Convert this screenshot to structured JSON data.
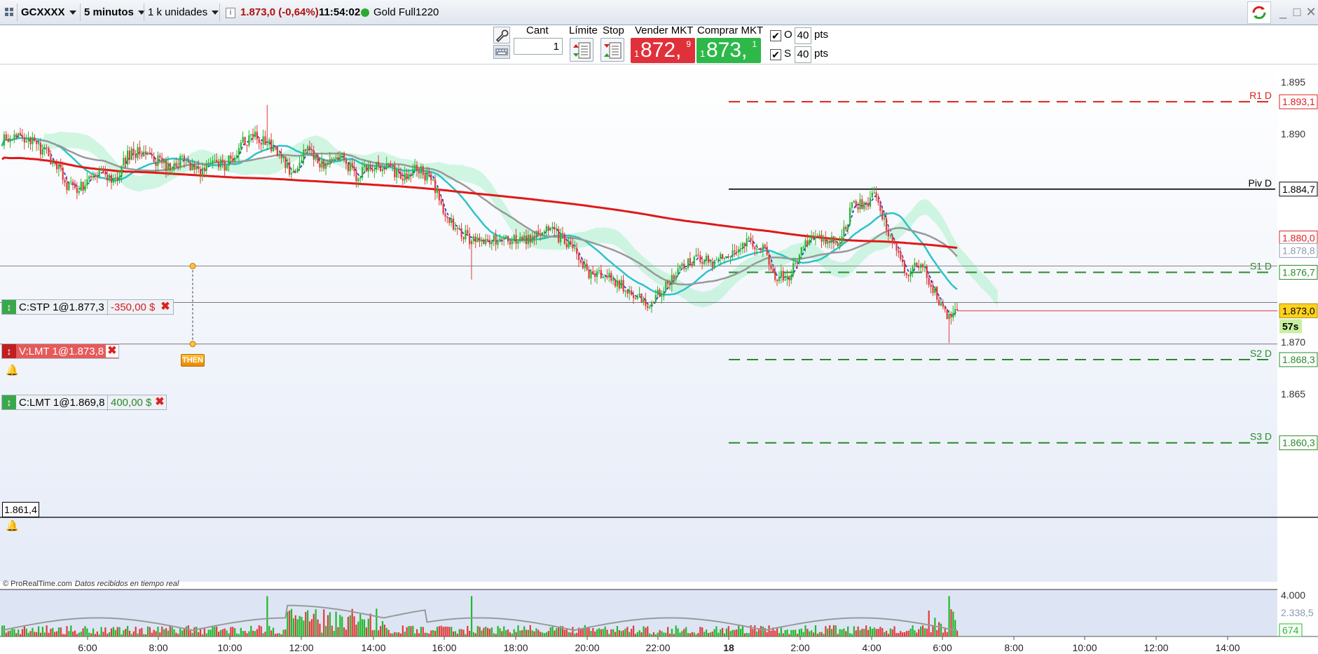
{
  "toolbar": {
    "instrument": "GCXXXX",
    "timeframe": "5 minutos",
    "units": "1 k unidades",
    "info_glyph": "i",
    "last_price": "1.873,0",
    "change": "(-0,64%)",
    "time": "11:54:02",
    "product": "Gold Full1220",
    "status_color": "#2ea82e",
    "icons": [
      "grid-icon",
      "info-icon",
      "sync-icon",
      "minimize-icon",
      "maximize-icon",
      "close-icon"
    ]
  },
  "trading": {
    "qty_label": "Cant",
    "qty_value": "1",
    "limit_label": "Límite",
    "stop_label": "Stop",
    "sell_label": "Vender MKT",
    "buy_label": "Comprar MKT",
    "sell": {
      "qty": "1",
      "price": "872,",
      "sup": "9",
      "color": "#e0303a"
    },
    "buy": {
      "qty": "1",
      "price": "873,",
      "sup": "1",
      "color": "#2fb84a"
    },
    "o_label": "O",
    "o_pts": "40",
    "s_label": "S",
    "s_pts": "40",
    "pts_label": "pts",
    "check_glyph": "✔"
  },
  "orders": [
    {
      "label": "C:STP 1@1.877,3",
      "pnl": "-350,00 $",
      "side": "buy"
    },
    {
      "label": "V:LMT 1@1.873,8",
      "pnl": "",
      "side": "sell"
    },
    {
      "label": "C:LMT 1@1.869,8",
      "pnl": "400,00 $",
      "side": "buy"
    }
  ],
  "order_glyphs": {
    "handle": "↕",
    "close": "✖",
    "bell": "🔔"
  },
  "then_label": "THEN",
  "low_label": "1.861,4",
  "credit": {
    "brand": "© ProRealTime.com",
    "note": "Datos recibidos en tiempo real"
  },
  "chart_data": {
    "type": "candlestick",
    "price_axis_ticks": [
      "1.895",
      "1.890",
      "1.865",
      "1.870",
      "1.865"
    ],
    "price_ticks": [
      1895,
      1890,
      1870,
      1865
    ],
    "price_labels": [
      "1.895",
      "1.890",
      "1.870",
      "1.865"
    ],
    "ylim": [
      1857.0,
      1897.0
    ],
    "time_labels": [
      "6:00",
      "8:00",
      "10:00",
      "12:00",
      "14:00",
      "16:00",
      "18:00",
      "20:00",
      "22:00",
      "18",
      "2:00",
      "4:00",
      "6:00",
      "8:00",
      "10:00",
      "12:00",
      "14:00"
    ],
    "pivots": [
      {
        "name": "R1 D",
        "value": 1893.1,
        "label": "1.893,1",
        "color": "#e02020",
        "style": "dashed"
      },
      {
        "name": "Piv D",
        "value": 1884.7,
        "label": "1.884,7",
        "color": "#000000",
        "style": "solid"
      },
      {
        "name": "S1 D",
        "value": 1876.7,
        "label": "1.876,7",
        "color": "#2a8a2a",
        "style": "dashed"
      },
      {
        "name": "S2 D",
        "value": 1868.3,
        "label": "1.868,3",
        "color": "#2a8a2a",
        "style": "dashed"
      },
      {
        "name": "S3 D",
        "value": 1860.3,
        "label": "1.860,3",
        "color": "#2a8a2a",
        "style": "dashed"
      }
    ],
    "current_price": {
      "value": 1873.0,
      "label": "1.873,0",
      "countdown": "57s"
    },
    "right_labels": [
      {
        "value": 1880.0,
        "label": "1.880,0",
        "color": "#e02020"
      },
      {
        "value": 1878.8,
        "label": "1.878,8",
        "color": "#8a9bb0"
      }
    ],
    "close_path": [
      [
        0,
        1889.5
      ],
      [
        10,
        1889.8
      ],
      [
        20,
        1888.5
      ],
      [
        27,
        1887.0
      ],
      [
        32,
        1884.9
      ],
      [
        38,
        1884.8
      ],
      [
        48,
        1886.5
      ],
      [
        55,
        1885.5
      ],
      [
        62,
        1887.8
      ],
      [
        68,
        1888.4
      ],
      [
        75,
        1887.5
      ],
      [
        82,
        1887.0
      ],
      [
        90,
        1887.5
      ],
      [
        97,
        1886.2
      ],
      [
        104,
        1887.5
      ],
      [
        110,
        1887.0
      ],
      [
        118,
        1889.0
      ],
      [
        124,
        1890.0
      ],
      [
        130,
        1889.3
      ],
      [
        137,
        1887.8
      ],
      [
        144,
        1886.0
      ],
      [
        150,
        1888.5
      ],
      [
        155,
        1887.5
      ],
      [
        160,
        1887.0
      ],
      [
        167,
        1888.0
      ],
      [
        175,
        1885.9
      ],
      [
        180,
        1886.8
      ],
      [
        190,
        1886.8
      ],
      [
        200,
        1885.7
      ],
      [
        205,
        1886.8
      ],
      [
        212,
        1885.5
      ],
      [
        220,
        1882.0
      ],
      [
        226,
        1880.5
      ],
      [
        232,
        1879.9
      ],
      [
        238,
        1879.8
      ],
      [
        262,
        1880.0
      ],
      [
        270,
        1880.9
      ],
      [
        280,
        1879.3
      ],
      [
        290,
        1876.5
      ],
      [
        298,
        1876.8
      ],
      [
        305,
        1875.5
      ],
      [
        312,
        1874.7
      ],
      [
        318,
        1873.4
      ],
      [
        326,
        1874.9
      ],
      [
        334,
        1876.8
      ],
      [
        342,
        1878.0
      ],
      [
        350,
        1877.6
      ],
      [
        360,
        1878.6
      ],
      [
        368,
        1879.5
      ],
      [
        376,
        1879.0
      ],
      [
        382,
        1876.5
      ],
      [
        388,
        1876.0
      ],
      [
        394,
        1878.5
      ],
      [
        400,
        1880.1
      ],
      [
        408,
        1880.0
      ],
      [
        414,
        1879.7
      ],
      [
        420,
        1882.9
      ],
      [
        428,
        1883.6
      ],
      [
        432,
        1884.0
      ],
      [
        436,
        1881.8
      ],
      [
        440,
        1879.3
      ],
      [
        444,
        1878.0
      ],
      [
        448,
        1876.0
      ],
      [
        452,
        1877.8
      ],
      [
        456,
        1876.9
      ],
      [
        460,
        1875.2
      ],
      [
        464,
        1873.4
      ],
      [
        468,
        1872.4
      ],
      [
        472,
        1873.5
      ]
    ],
    "volume_axis": {
      "max": 4000,
      "max_label": "4.000",
      "avg_label": "2.338,5",
      "last_label": "674"
    }
  }
}
